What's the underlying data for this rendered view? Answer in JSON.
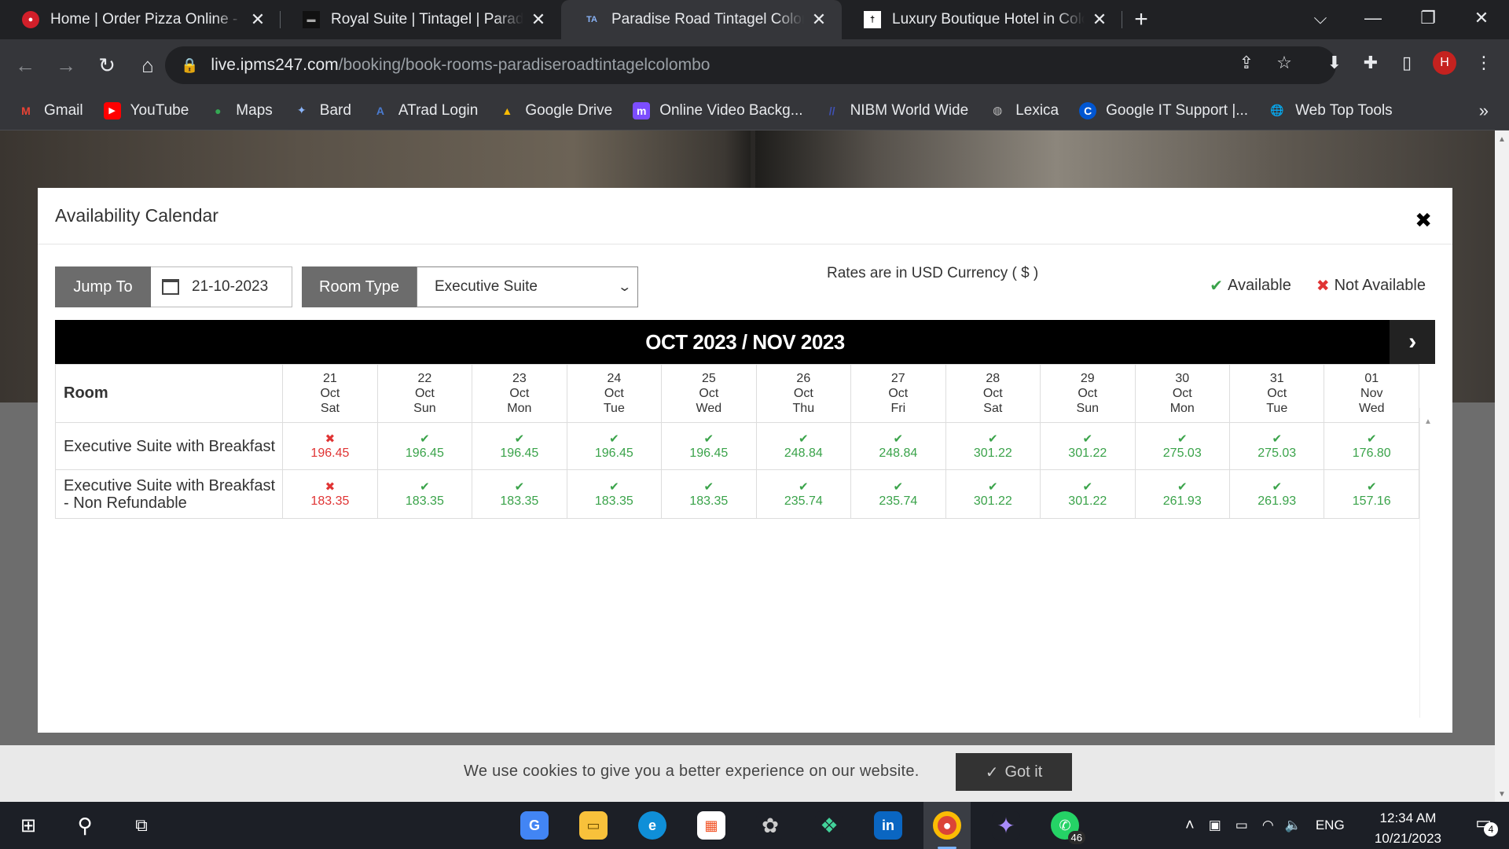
{
  "browser": {
    "tabs": [
      {
        "title": "Home | Order Pizza Online - Deli",
        "favicon": "pizza-hut-icon",
        "active": false
      },
      {
        "title": "Royal Suite | Tintagel | Paradise Road",
        "favicon": "paradise-road-icon",
        "active": false
      },
      {
        "title": "Paradise Road Tintagel Colombo",
        "favicon": "ipms-icon",
        "active": true
      },
      {
        "title": "Luxury Boutique Hotel in Colombo",
        "favicon": "tintagel-icon",
        "active": false
      }
    ],
    "url_host": "live.ipms247.com",
    "url_path": "/booking/book-rooms-paradiseroadtintagelcolombo",
    "profile_initial": "H",
    "bookmarks": [
      {
        "label": "Gmail",
        "icon": "gmail-icon",
        "color": "#ea4335"
      },
      {
        "label": "YouTube",
        "icon": "youtube-icon",
        "color": "#ff0000"
      },
      {
        "label": "Maps",
        "icon": "maps-icon",
        "color": "#34a853"
      },
      {
        "label": "Bard",
        "icon": "bard-icon",
        "color": "#8ab4f8"
      },
      {
        "label": "ATrad Login",
        "icon": "atrad-icon",
        "color": "#4a7bd0"
      },
      {
        "label": "Google Drive",
        "icon": "drive-icon",
        "color": "#fbbc04"
      },
      {
        "label": "Online Video Backg...",
        "icon": "video-bg-icon",
        "color": "#7c4dff"
      },
      {
        "label": "NIBM World Wide",
        "icon": "nibm-icon",
        "color": "#3f51b5"
      },
      {
        "label": "Lexica",
        "icon": "lexica-icon",
        "color": "#9e9e9e"
      },
      {
        "label": "Google IT Support |...",
        "icon": "coursera-icon",
        "color": "#0056d2"
      },
      {
        "label": "Web Top Tools",
        "icon": "globe-icon",
        "color": "#1e88e5"
      }
    ]
  },
  "modal": {
    "title": "Availability Calendar",
    "jump_to_label": "Jump To",
    "date_value": "21-10-2023",
    "room_type_label": "Room Type",
    "room_type_value": "Executive Suite",
    "rates_note": "Rates are in USD Currency ( $ )",
    "legend_available": "Available",
    "legend_not_available": "Not Available",
    "calendar_period": "OCT 2023 / NOV 2023",
    "room_header": "Room",
    "days": [
      {
        "d": "21",
        "m": "Oct",
        "w": "Sat"
      },
      {
        "d": "22",
        "m": "Oct",
        "w": "Sun"
      },
      {
        "d": "23",
        "m": "Oct",
        "w": "Mon"
      },
      {
        "d": "24",
        "m": "Oct",
        "w": "Tue"
      },
      {
        "d": "25",
        "m": "Oct",
        "w": "Wed"
      },
      {
        "d": "26",
        "m": "Oct",
        "w": "Thu"
      },
      {
        "d": "27",
        "m": "Oct",
        "w": "Fri"
      },
      {
        "d": "28",
        "m": "Oct",
        "w": "Sat"
      },
      {
        "d": "29",
        "m": "Oct",
        "w": "Sun"
      },
      {
        "d": "30",
        "m": "Oct",
        "w": "Mon"
      },
      {
        "d": "31",
        "m": "Oct",
        "w": "Tue"
      },
      {
        "d": "01",
        "m": "Nov",
        "w": "Wed"
      }
    ],
    "rooms": [
      {
        "name_line1": "Executive Suite with Breakfast",
        "name_line2": "",
        "rates": [
          "196.45",
          "196.45",
          "196.45",
          "196.45",
          "196.45",
          "248.84",
          "248.84",
          "301.22",
          "301.22",
          "275.03",
          "275.03",
          "176.80"
        ],
        "available": [
          false,
          true,
          true,
          true,
          true,
          true,
          true,
          true,
          true,
          true,
          true,
          true
        ]
      },
      {
        "name_line1": "Executive Suite with Breakfast",
        "name_line2": "- Non Refundable",
        "rates": [
          "183.35",
          "183.35",
          "183.35",
          "183.35",
          "183.35",
          "235.74",
          "235.74",
          "301.22",
          "301.22",
          "261.93",
          "261.93",
          "157.16"
        ],
        "available": [
          false,
          true,
          true,
          true,
          true,
          true,
          true,
          true,
          true,
          true,
          true,
          true
        ]
      }
    ]
  },
  "cookie": {
    "text": "We use cookies to give you a better experience on our website.",
    "button": "Got it"
  },
  "taskbar": {
    "apps": [
      "google-translate-icon",
      "file-explorer-icon",
      "edge-icon",
      "store-icon",
      "chatgpt-icon",
      "app-icon",
      "linkedin-icon",
      "chrome-icon",
      "copilot-icon",
      "whatsapp-icon"
    ],
    "whatsapp_badge": "46",
    "language": "ENG",
    "time": "12:34 AM",
    "date": "10/21/2023",
    "notifications": "4"
  },
  "colors": {
    "available": "#3aa34a",
    "not_available": "#e03434",
    "calendar_header": "#000000"
  }
}
